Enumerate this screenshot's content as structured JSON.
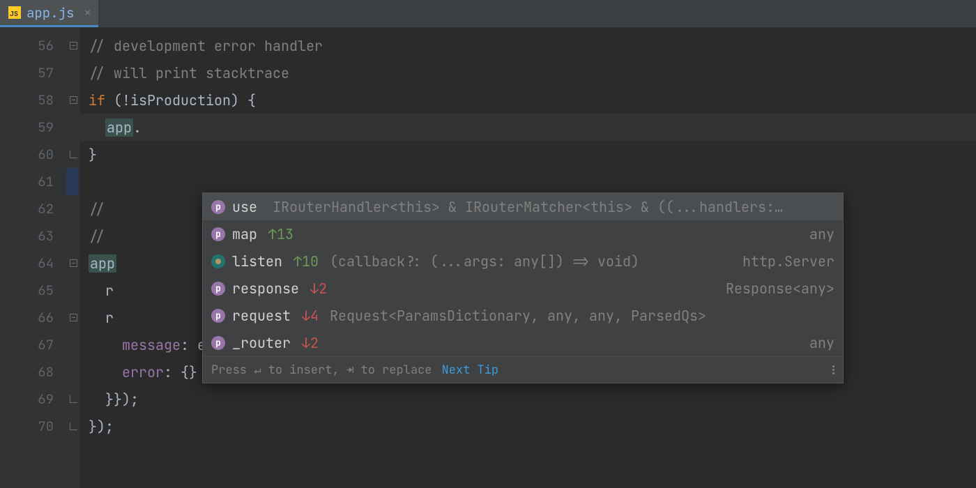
{
  "tab": {
    "filename": "app.js",
    "icon": "js"
  },
  "gutter_start": 56,
  "lines": [
    {
      "n": 56,
      "fold": "open",
      "tokens": [
        {
          "t": "// development error handler",
          "c": "comment"
        }
      ]
    },
    {
      "n": 57,
      "fold": "none",
      "tokens": [
        {
          "t": "// will print stacktrace",
          "c": "comment"
        }
      ]
    },
    {
      "n": 58,
      "fold": "open",
      "tokens": [
        {
          "t": "if ",
          "c": "keyword"
        },
        {
          "t": "(!isProduction) {",
          "c": "ident"
        }
      ]
    },
    {
      "n": 59,
      "fold": "none",
      "hl": true,
      "tokens": [
        {
          "t": "  ",
          "c": "ident"
        },
        {
          "t": "app",
          "c": "hl-ident"
        },
        {
          "t": ".",
          "c": "ident"
        }
      ]
    },
    {
      "n": 60,
      "fold": "end",
      "tokens": [
        {
          "t": "}",
          "c": "ident"
        }
      ]
    },
    {
      "n": 61,
      "fold": "none",
      "tokens": []
    },
    {
      "n": 62,
      "fold": "none",
      "tokens": [
        {
          "t": "// ",
          "c": "comment"
        }
      ]
    },
    {
      "n": 63,
      "fold": "none",
      "tokens": [
        {
          "t": "// ",
          "c": "comment"
        }
      ]
    },
    {
      "n": 64,
      "fold": "open",
      "tokens": [
        {
          "t": "app",
          "c": "hl-ident"
        }
      ]
    },
    {
      "n": 65,
      "fold": "none",
      "tokens": [
        {
          "t": "  r",
          "c": "ident"
        }
      ]
    },
    {
      "n": 66,
      "fold": "open",
      "tokens": [
        {
          "t": "  r",
          "c": "ident"
        }
      ]
    },
    {
      "n": 67,
      "fold": "none",
      "tokens": [
        {
          "t": "    message: err.message,",
          "c": "ident"
        }
      ]
    },
    {
      "n": 68,
      "fold": "none",
      "tokens": [
        {
          "t": "    error: {}",
          "c": "ident"
        }
      ]
    },
    {
      "n": 69,
      "fold": "end",
      "tokens": [
        {
          "t": "  }});",
          "c": "ident"
        }
      ]
    },
    {
      "n": 70,
      "fold": "end",
      "tokens": [
        {
          "t": "});",
          "c": "ident"
        }
      ]
    }
  ],
  "autocomplete": {
    "items": [
      {
        "icon": "prop",
        "name": "use",
        "rank": "",
        "rank_dir": "",
        "sig": "IRouterHandler<this> & IRouterMatcher<this> & ((...handlers:…",
        "type": "",
        "selected": true
      },
      {
        "icon": "prop",
        "name": "map",
        "rank": "↑13",
        "rank_dir": "up",
        "sig": "",
        "type": "any"
      },
      {
        "icon": "fn",
        "name": "listen",
        "rank": "↑10",
        "rank_dir": "up",
        "sig": "(callback?: (...args: any[]) => void)",
        "type": "http.Server"
      },
      {
        "icon": "prop",
        "name": "response",
        "rank": "↓2",
        "rank_dir": "down",
        "sig": "",
        "type": "Response<any>"
      },
      {
        "icon": "prop",
        "name": "request",
        "rank": "↓4",
        "rank_dir": "down",
        "sig": "Request<ParamsDictionary, any, any, ParsedQs>",
        "type": ""
      },
      {
        "icon": "prop",
        "name": "_router",
        "rank": "↓2",
        "rank_dir": "down",
        "sig": "",
        "type": "any"
      }
    ],
    "footer_hint": "Press ↵ to insert, ⇥ to replace",
    "next_tip": "Next Tip"
  },
  "styled_lines": {
    "67": [
      {
        "t": "    ",
        "c": "ident"
      },
      {
        "t": "message",
        "c": "prop"
      },
      {
        "t": ": err.message,",
        "c": "ident"
      }
    ],
    "68": [
      {
        "t": "    ",
        "c": "ident"
      },
      {
        "t": "error",
        "c": "prop"
      },
      {
        "t": ": {}",
        "c": "ident"
      }
    ]
  }
}
